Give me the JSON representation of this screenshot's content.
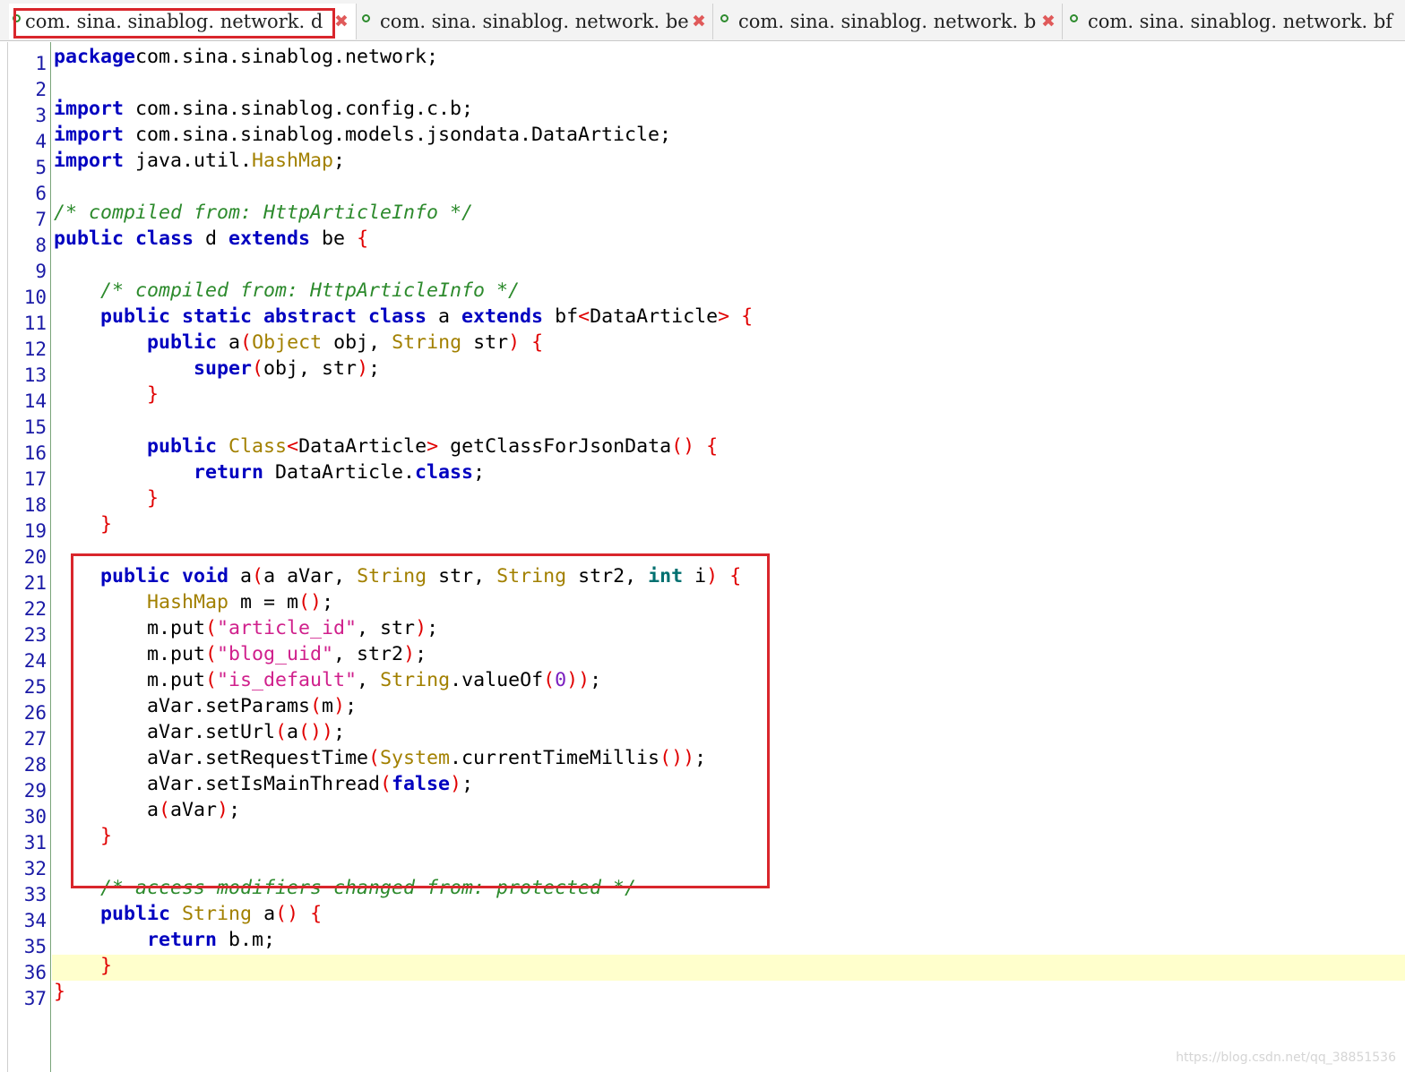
{
  "tabs": [
    {
      "label": "com. sina. sinablog. network. d",
      "active": true
    },
    {
      "label": "com. sina. sinablog. network. be",
      "active": false
    },
    {
      "label": "com. sina. sinablog. network. b",
      "active": false
    },
    {
      "label": "com. sina. sinablog. network. bf",
      "active": false
    }
  ],
  "colors": {
    "highlight_box": "#d9262c",
    "keyword": "#0000c0",
    "type": "#a28000",
    "comment": "#2c8a2c",
    "string": "#d0208c",
    "bracket": "#e00000",
    "current_line": "#ffffcc"
  },
  "icons": {
    "tab_icon": "class-file-icon",
    "close_icon": "close-icon"
  },
  "editor": {
    "current_line": 36,
    "line_numbers": [
      "1",
      "2",
      "3",
      "4",
      "5",
      "6",
      "7",
      "8",
      "9",
      "10",
      "11",
      "12",
      "13",
      "14",
      "15",
      "16",
      "17",
      "18",
      "19",
      "20",
      "21",
      "22",
      "23",
      "24",
      "25",
      "26",
      "27",
      "28",
      "29",
      "30",
      "31",
      "32",
      "33",
      "34",
      "35",
      "36",
      "37"
    ],
    "lines": [
      [
        [
          "kw",
          "package"
        ],
        [
          "",
          "com.sina.sinablog.network;"
        ]
      ],
      [],
      [
        [
          "kw",
          "import"
        ],
        [
          "",
          " com.sina.sinablog.config.c.b;"
        ]
      ],
      [
        [
          "kw",
          "import"
        ],
        [
          "",
          " com.sina.sinablog.models.jsondata.DataArticle;"
        ]
      ],
      [
        [
          "kw",
          "import"
        ],
        [
          "",
          " java.util."
        ],
        [
          "ty",
          "HashMap"
        ],
        [
          "",
          ";"
        ]
      ],
      [],
      [
        [
          "cm",
          "/* compiled from: HttpArticleInfo */"
        ]
      ],
      [
        [
          "kw",
          "public class"
        ],
        [
          "",
          " d "
        ],
        [
          "kw",
          "extends"
        ],
        [
          "",
          " be "
        ],
        [
          "br",
          "{"
        ]
      ],
      [],
      [
        [
          "",
          "    "
        ],
        [
          "cm",
          "/* compiled from: HttpArticleInfo */"
        ]
      ],
      [
        [
          "",
          "    "
        ],
        [
          "kw",
          "public static abstract class"
        ],
        [
          "",
          " a "
        ],
        [
          "kw",
          "extends"
        ],
        [
          "",
          " bf"
        ],
        [
          "br",
          "<"
        ],
        [
          "",
          "DataArticle"
        ],
        [
          "br",
          ">"
        ],
        [
          "",
          " "
        ],
        [
          "br",
          "{"
        ]
      ],
      [
        [
          "",
          "        "
        ],
        [
          "kw",
          "public"
        ],
        [
          "",
          " a"
        ],
        [
          "br",
          "("
        ],
        [
          "ty",
          "Object"
        ],
        [
          "",
          " obj, "
        ],
        [
          "ty",
          "String"
        ],
        [
          "",
          " str"
        ],
        [
          "br",
          ")"
        ],
        [
          "",
          " "
        ],
        [
          "br",
          "{"
        ]
      ],
      [
        [
          "",
          "            "
        ],
        [
          "kw",
          "super"
        ],
        [
          "br",
          "("
        ],
        [
          "",
          "obj, str"
        ],
        [
          "br",
          ")"
        ],
        [
          "",
          ";"
        ]
      ],
      [
        [
          "",
          "        "
        ],
        [
          "br",
          "}"
        ]
      ],
      [],
      [
        [
          "",
          "        "
        ],
        [
          "kw",
          "public"
        ],
        [
          "",
          " "
        ],
        [
          "ty",
          "Class"
        ],
        [
          "br",
          "<"
        ],
        [
          "",
          "DataArticle"
        ],
        [
          "br",
          ">"
        ],
        [
          "",
          " getClassForJsonData"
        ],
        [
          "br",
          "()"
        ],
        [
          "",
          " "
        ],
        [
          "br",
          "{"
        ]
      ],
      [
        [
          "",
          "            "
        ],
        [
          "kw",
          "return"
        ],
        [
          "",
          " DataArticle."
        ],
        [
          "kw",
          "class"
        ],
        [
          "",
          ";"
        ]
      ],
      [
        [
          "",
          "        "
        ],
        [
          "br",
          "}"
        ]
      ],
      [
        [
          "",
          "    "
        ],
        [
          "br",
          "}"
        ]
      ],
      [],
      [
        [
          "",
          "    "
        ],
        [
          "kw",
          "public void"
        ],
        [
          "",
          " a"
        ],
        [
          "br",
          "("
        ],
        [
          "",
          "a aVar, "
        ],
        [
          "ty",
          "String"
        ],
        [
          "",
          " str, "
        ],
        [
          "ty",
          "String"
        ],
        [
          "",
          " str2, "
        ],
        [
          "kwt",
          "int"
        ],
        [
          "",
          " i"
        ],
        [
          "br",
          ")"
        ],
        [
          "",
          " "
        ],
        [
          "br",
          "{"
        ]
      ],
      [
        [
          "",
          "        "
        ],
        [
          "ty",
          "HashMap"
        ],
        [
          "",
          " m = m"
        ],
        [
          "br",
          "()"
        ],
        [
          "",
          ";"
        ]
      ],
      [
        [
          "",
          "        m.put"
        ],
        [
          "br",
          "("
        ],
        [
          "st",
          "\"article_id\""
        ],
        [
          "",
          ", str"
        ],
        [
          "br",
          ")"
        ],
        [
          "",
          ";"
        ]
      ],
      [
        [
          "",
          "        m.put"
        ],
        [
          "br",
          "("
        ],
        [
          "st",
          "\"blog_uid\""
        ],
        [
          "",
          ", str2"
        ],
        [
          "br",
          ")"
        ],
        [
          "",
          ";"
        ]
      ],
      [
        [
          "",
          "        m.put"
        ],
        [
          "br",
          "("
        ],
        [
          "st",
          "\"is_default\""
        ],
        [
          "",
          ", "
        ],
        [
          "ty",
          "String"
        ],
        [
          "",
          ".valueOf"
        ],
        [
          "br",
          "("
        ],
        [
          "nm",
          "0"
        ],
        [
          "br",
          "))"
        ],
        [
          "",
          ";"
        ]
      ],
      [
        [
          "",
          "        aVar.setParams"
        ],
        [
          "br",
          "("
        ],
        [
          "",
          "m"
        ],
        [
          "br",
          ")"
        ],
        [
          "",
          ";"
        ]
      ],
      [
        [
          "",
          "        aVar.setUrl"
        ],
        [
          "br",
          "("
        ],
        [
          "",
          "a"
        ],
        [
          "br",
          "())"
        ],
        [
          "",
          ";"
        ]
      ],
      [
        [
          "",
          "        aVar.setRequestTime"
        ],
        [
          "br",
          "("
        ],
        [
          "ty",
          "System"
        ],
        [
          "",
          ".currentTimeMillis"
        ],
        [
          "br",
          "())"
        ],
        [
          "",
          ";"
        ]
      ],
      [
        [
          "",
          "        aVar.setIsMainThread"
        ],
        [
          "br",
          "("
        ],
        [
          "kw",
          "false"
        ],
        [
          "br",
          ")"
        ],
        [
          "",
          ";"
        ]
      ],
      [
        [
          "",
          "        a"
        ],
        [
          "br",
          "("
        ],
        [
          "",
          "aVar"
        ],
        [
          "br",
          ")"
        ],
        [
          "",
          ";"
        ]
      ],
      [
        [
          "",
          "    "
        ],
        [
          "br",
          "}"
        ]
      ],
      [],
      [
        [
          "",
          "    "
        ],
        [
          "cm",
          "/* access modifiers changed from: protected */"
        ]
      ],
      [
        [
          "",
          "    "
        ],
        [
          "kw",
          "public"
        ],
        [
          "",
          " "
        ],
        [
          "ty",
          "String"
        ],
        [
          "",
          " a"
        ],
        [
          "br",
          "()"
        ],
        [
          "",
          " "
        ],
        [
          "br",
          "{"
        ]
      ],
      [
        [
          "",
          "        "
        ],
        [
          "kw",
          "return"
        ],
        [
          "",
          " b.m;"
        ]
      ],
      [
        [
          "",
          "    "
        ],
        [
          "br",
          "}"
        ]
      ],
      [
        [
          "br",
          "}"
        ]
      ]
    ]
  },
  "watermark": "https://blog.csdn.net/qq_38851536"
}
